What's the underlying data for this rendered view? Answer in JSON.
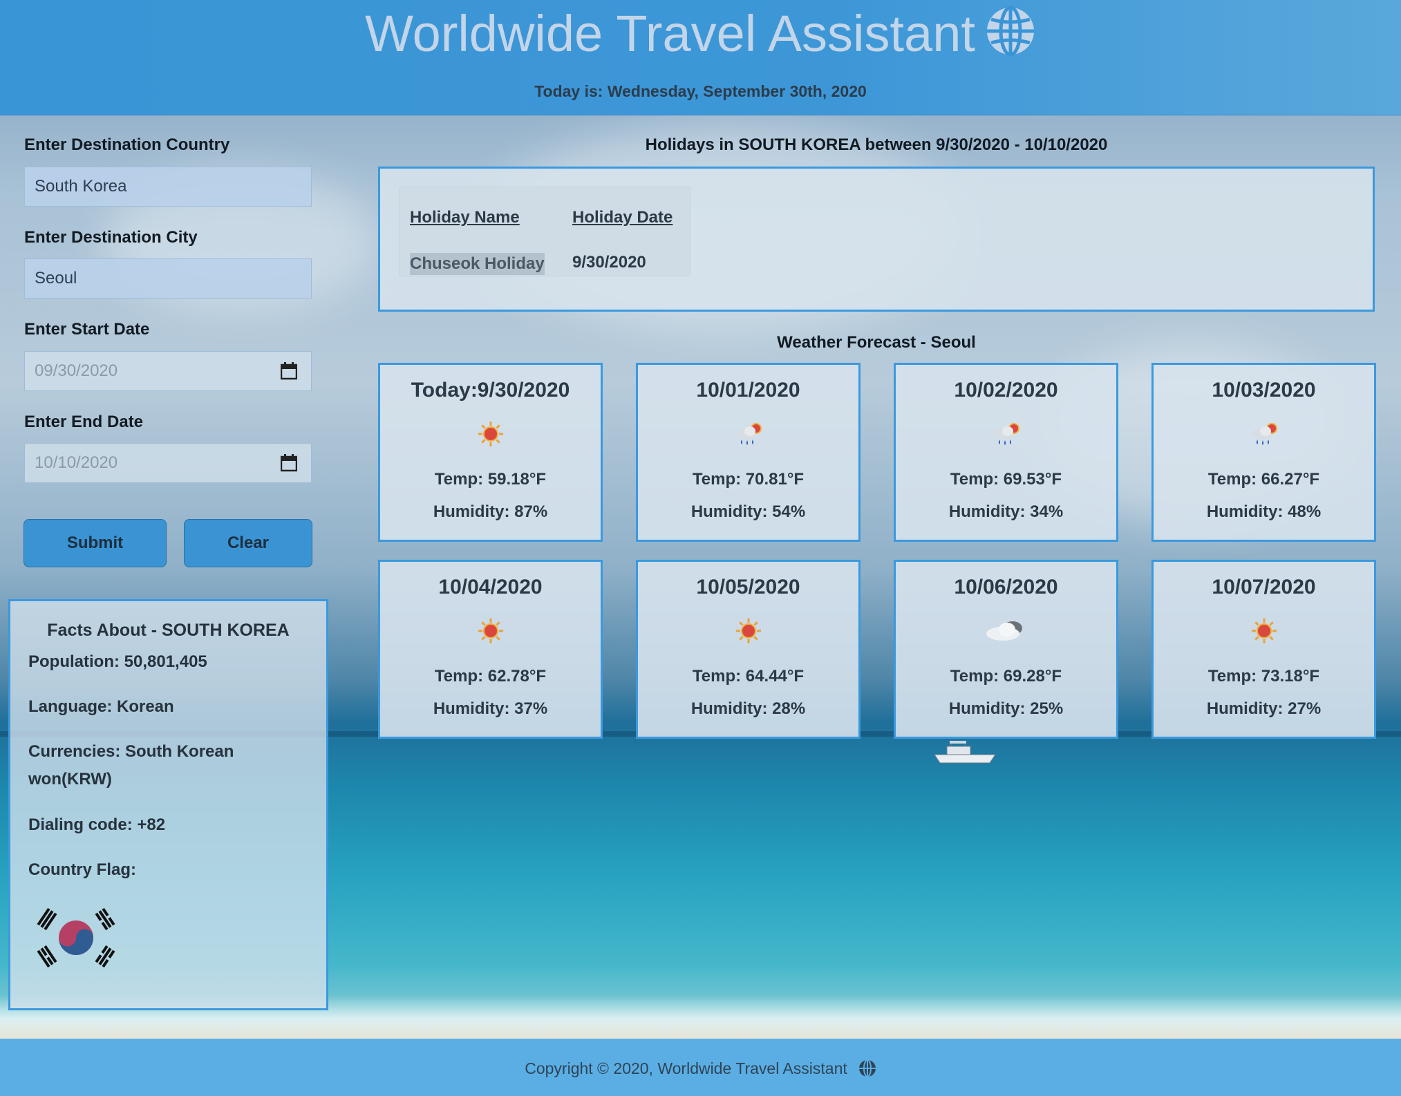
{
  "header": {
    "title": "Worldwide Travel Assistant",
    "today": "Today is: Wednesday, September 30th, 2020"
  },
  "form": {
    "country_label": "Enter Destination Country",
    "country_value": "South Korea",
    "city_label": "Enter Destination City",
    "city_value": "Seoul",
    "start_label": "Enter Start Date",
    "start_value": "09/30/2020",
    "end_label": "Enter End Date",
    "end_value": "10/10/2020",
    "submit_label": "Submit",
    "clear_label": "Clear"
  },
  "facts": {
    "title": "Facts About - SOUTH KOREA",
    "population": "Population: 50,801,405",
    "language": "Language: Korean",
    "currencies": "Currencies: South Korean won(KRW)",
    "dialing": "Dialing code: +82",
    "flag_label": "Country Flag:"
  },
  "holidays": {
    "title": "Holidays in SOUTH KOREA between 9/30/2020 - 10/10/2020",
    "col_name": "Holiday Name",
    "col_date": "Holiday Date",
    "rows": [
      {
        "name": "Chuseok Holiday",
        "date": "9/30/2020"
      }
    ]
  },
  "weather": {
    "title": "Weather Forecast - Seoul",
    "cards": [
      {
        "date": "Today:9/30/2020",
        "icon": "sun-icon",
        "temp": "Temp: 59.18°F",
        "humidity": "Humidity: 87%"
      },
      {
        "date": "10/01/2020",
        "icon": "rain-sun-icon",
        "temp": "Temp: 70.81°F",
        "humidity": "Humidity: 54%"
      },
      {
        "date": "10/02/2020",
        "icon": "rain-sun-icon",
        "temp": "Temp: 69.53°F",
        "humidity": "Humidity: 34%"
      },
      {
        "date": "10/03/2020",
        "icon": "rain-sun-icon",
        "temp": "Temp: 66.27°F",
        "humidity": "Humidity: 48%"
      },
      {
        "date": "10/04/2020",
        "icon": "sun-icon",
        "temp": "Temp: 62.78°F",
        "humidity": "Humidity: 37%"
      },
      {
        "date": "10/05/2020",
        "icon": "sun-icon",
        "temp": "Temp: 64.44°F",
        "humidity": "Humidity: 28%"
      },
      {
        "date": "10/06/2020",
        "icon": "cloud-icon",
        "temp": "Temp: 69.28°F",
        "humidity": "Humidity: 25%"
      },
      {
        "date": "10/07/2020",
        "icon": "sun-icon",
        "temp": "Temp: 73.18°F",
        "humidity": "Humidity: 27%"
      }
    ]
  },
  "footer": {
    "copyright": "Copyright © 2020, Worldwide Travel Assistant"
  }
}
